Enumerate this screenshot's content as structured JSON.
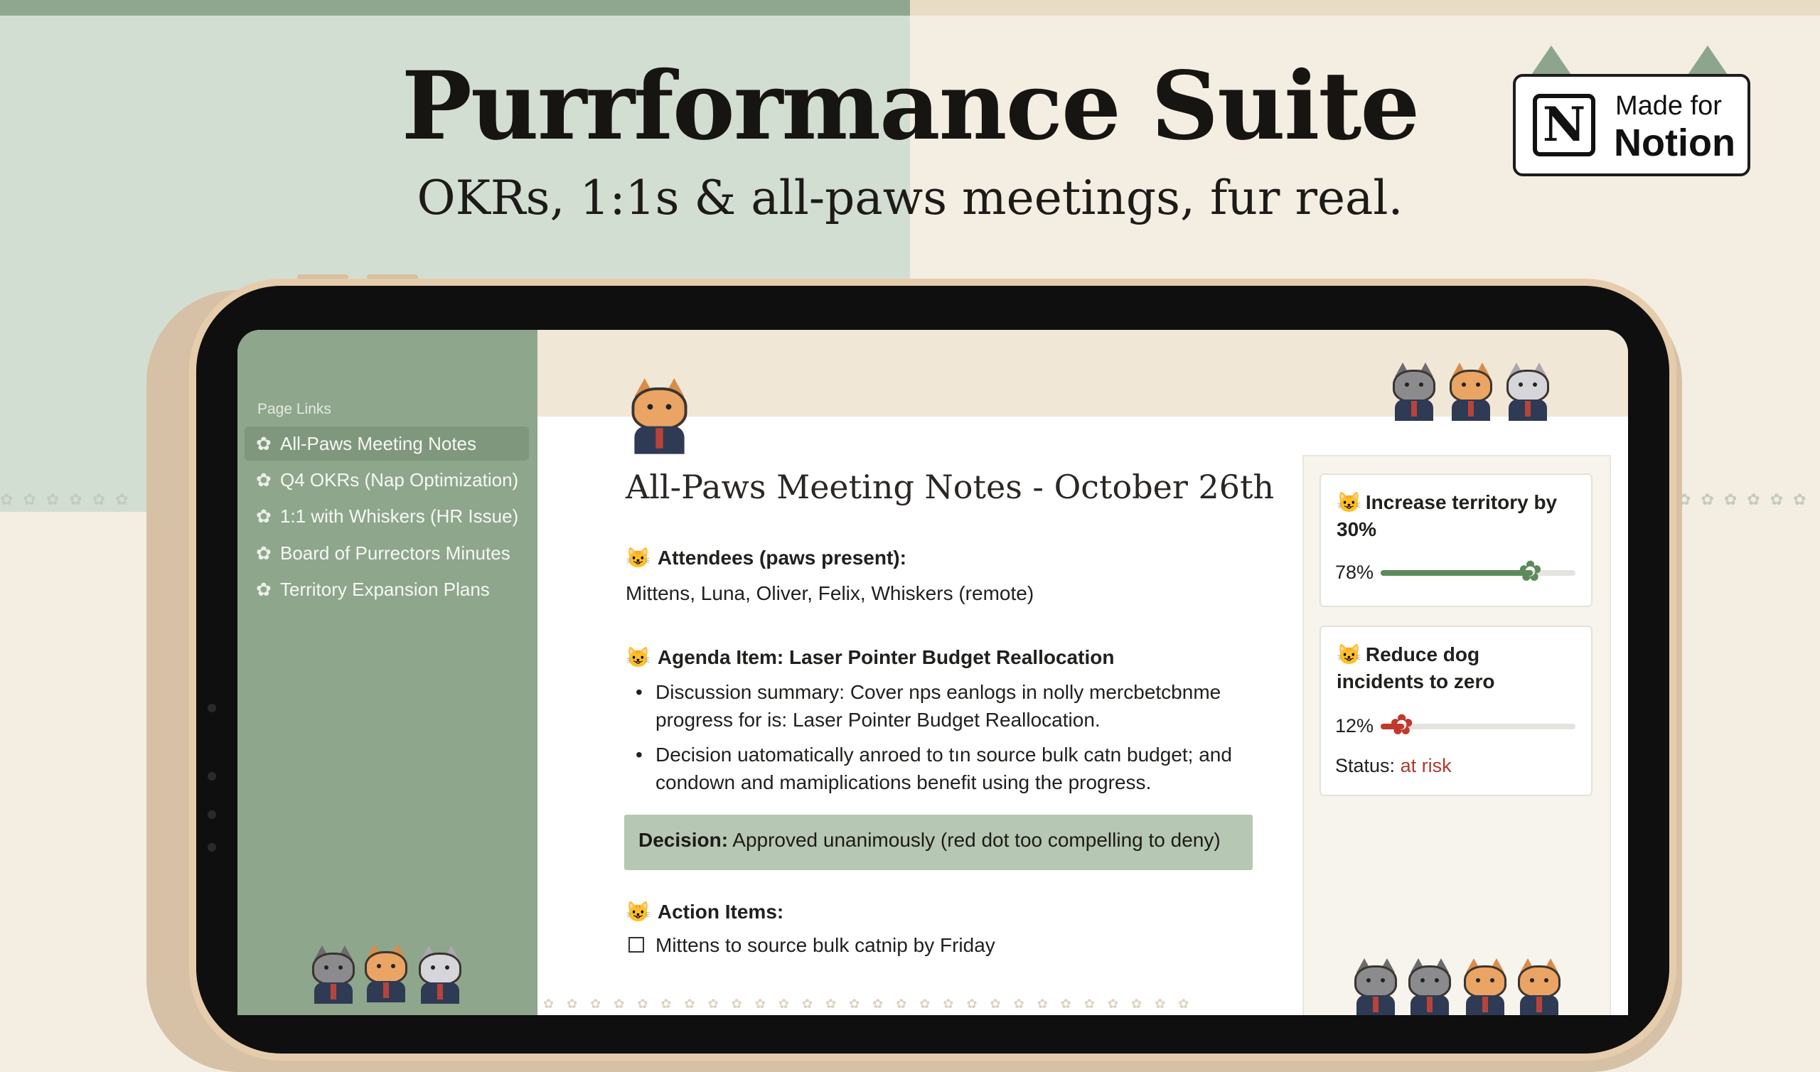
{
  "hero": {
    "title": "Purrformance Suite",
    "subtitle": "OKRs, 1:1s & all-paws meetings, fur real."
  },
  "badge": {
    "logo_letter": "N",
    "made_for": "Made for",
    "brand": "Notion"
  },
  "sidebar": {
    "heading": "Page Links",
    "items": [
      {
        "label": "All-Paws Meeting Notes",
        "active": true
      },
      {
        "label": "Q4 OKRs (Nap Optimization)",
        "active": false
      },
      {
        "label": "1:1 with Whiskers (HR Issue)",
        "active": false
      },
      {
        "label": "Board of Purrectors Minutes",
        "active": false
      },
      {
        "label": "Territory Expansion Plans",
        "active": false
      }
    ]
  },
  "doc": {
    "title": "All-Paws Meeting Notes - October 26th",
    "attendees_heading": "Attendees (paws present):",
    "attendees": "Mittens, Luna, Oliver, Felix, Whiskers (remote)",
    "agenda_heading": "Agenda Item: Laser Pointer Budget Reallocation",
    "bullets": [
      {
        "line1": "Discussion summary: Cover nps eanlogs in nolly mercbetсbnme",
        "line2": "progress for is: Laser Pointer Budget Reallocation."
      },
      {
        "line1": "Decision uatomatically anroed to tın source bulk catn budget; and",
        "line2": "condown and mamiplications benefit using the progress."
      }
    ],
    "decision_label": "Decision:",
    "decision_text": "Approved unanimously (red dot too compelling to deny)",
    "action_heading": "Action Items:",
    "action_items": [
      {
        "text": "Mittens to source bulk catnip by Friday",
        "checked": false
      }
    ]
  },
  "okrs": [
    {
      "title": "Increase territory by 30%",
      "percent_label": "78%",
      "progress": 0.78,
      "color": "#5d8a5b"
    },
    {
      "title": "Reduce dog incidents to zero",
      "percent_label": "12%",
      "progress": 0.12,
      "color": "#c0392b",
      "status_label": "Status:",
      "status_value": "at risk",
      "status_color": "#b03a2e"
    }
  ],
  "colors": {
    "sage": "#8ea68c",
    "cream": "#f4ede1",
    "accent_red": "#c0392b",
    "accent_green": "#5d8a5b"
  },
  "icons": {
    "sidebar_item": "paw-icon",
    "section": "cat-face-icon",
    "progress_knob": "paw-icon"
  }
}
